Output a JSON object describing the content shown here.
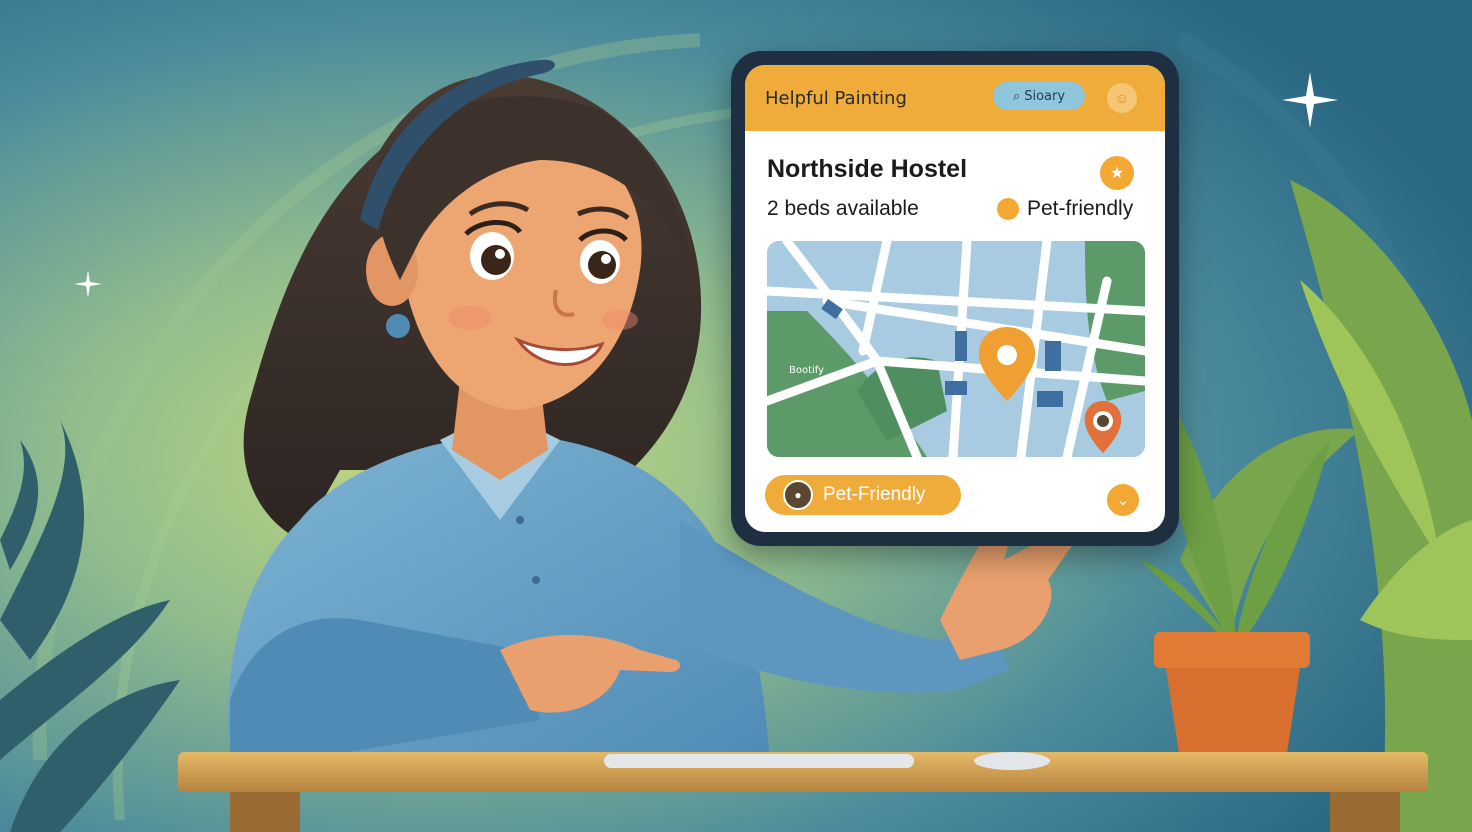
{
  "app": {
    "title": "Helpful Painting",
    "search_label": "Sioary",
    "search_icon": "search-icon",
    "profile_icon": "profile-icon"
  },
  "listing": {
    "name": "Northside Hostel",
    "availability": "2 beds available",
    "tag": "Pet-friendly",
    "favorite_icon": "favorite-icon"
  },
  "map": {
    "labels": {
      "district": "Bootify"
    },
    "pins": [
      "location-pin-icon",
      "pet-location-pin-icon"
    ]
  },
  "actions": {
    "pet_button_label": "Pet-Friendly",
    "expand_icon": "chevron-down-icon"
  },
  "colors": {
    "accent": "#f0ac3a",
    "search_pill": "#8fc6db",
    "map_water": "#a9cbe2",
    "map_park": "#5c9a6a",
    "tablet_frame": "#1f2f42"
  }
}
